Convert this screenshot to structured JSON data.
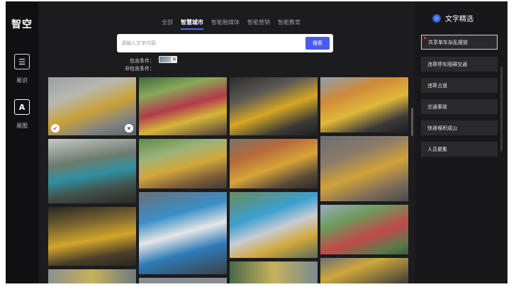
{
  "app": {
    "logo_text": "智空"
  },
  "sidebar": {
    "items": [
      {
        "icon_name": "scan-text-icon",
        "glyph": "☰",
        "label": "易识"
      },
      {
        "icon_name": "scan-a-icon",
        "glyph": "A",
        "label": "易图"
      }
    ]
  },
  "tabs": [
    {
      "label": "全部",
      "active": false
    },
    {
      "label": "智慧城市",
      "active": true
    },
    {
      "label": "智能融媒体",
      "active": false
    },
    {
      "label": "智能营销",
      "active": false
    },
    {
      "label": "智能教育",
      "active": false
    }
  ],
  "search": {
    "placeholder": "请输入文字内容",
    "value": "",
    "button_label": "搜索"
  },
  "conditions": {
    "include_label": "包含条件：",
    "exclude_label": "非包含条件："
  },
  "right_panel": {
    "title": "文字精选",
    "items": [
      {
        "label": "共享单车杂乱摆放",
        "active": true
      },
      {
        "label": "违章停车阻碍交通",
        "active": false
      },
      {
        "label": "违章占道",
        "active": false
      },
      {
        "label": "交通事故",
        "active": false
      },
      {
        "label": "快递堆积成山",
        "active": false
      },
      {
        "label": "人员聚集",
        "active": false
      }
    ]
  },
  "gallery": {
    "images": [
      {
        "name": "bike-image-1",
        "marker": "check"
      },
      {
        "name": "bike-image-2",
        "marker": ""
      },
      {
        "name": "bike-image-3",
        "marker": ""
      },
      {
        "name": "bike-image-4",
        "marker": ""
      },
      {
        "name": "bike-image-5",
        "marker": ""
      },
      {
        "name": "bike-image-6",
        "marker": ""
      },
      {
        "name": "bike-image-7",
        "marker": ""
      },
      {
        "name": "bike-image-8",
        "marker": ""
      },
      {
        "name": "bike-image-9",
        "marker": ""
      },
      {
        "name": "bike-image-10",
        "marker": ""
      },
      {
        "name": "bike-image-11",
        "marker": ""
      },
      {
        "name": "bike-image-12",
        "marker": ""
      },
      {
        "name": "bike-image-13",
        "marker": ""
      },
      {
        "name": "bike-image-14",
        "marker": ""
      },
      {
        "name": "bike-image-15",
        "marker": ""
      },
      {
        "name": "bike-image-16",
        "marker": ""
      }
    ],
    "check_glyph": "✔",
    "remove_glyph": "✕"
  },
  "colors": {
    "accent": "#4a5cf0",
    "tab_underline": "#3d6cff",
    "background": "#1c1c1f"
  }
}
